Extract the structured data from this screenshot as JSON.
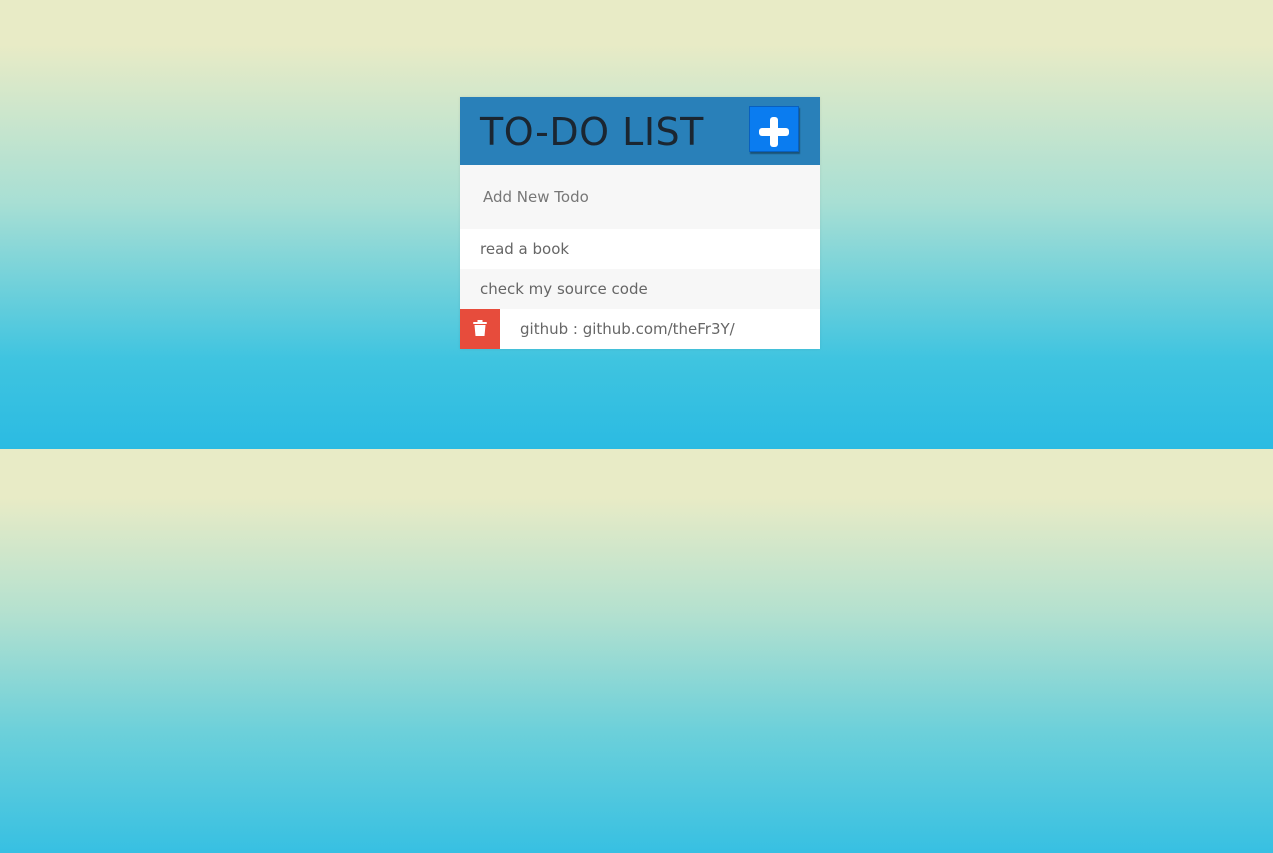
{
  "header": {
    "title": "TO-DO LIST",
    "add_icon": "plus-icon",
    "accent_color": "#2980b9",
    "button_color": "#0a7cf0"
  },
  "new_todo": {
    "placeholder": "Add New Todo",
    "value": ""
  },
  "todos": [
    {
      "text": "read a book"
    },
    {
      "text": "check my source code"
    },
    {
      "text": "github : github.com/theFr3Y/",
      "delete_icon": "trash-icon"
    }
  ],
  "colors": {
    "delete": "#e74c3c",
    "background_top": "#e8ebc6",
    "background_bottom": "#2bbbe2"
  }
}
